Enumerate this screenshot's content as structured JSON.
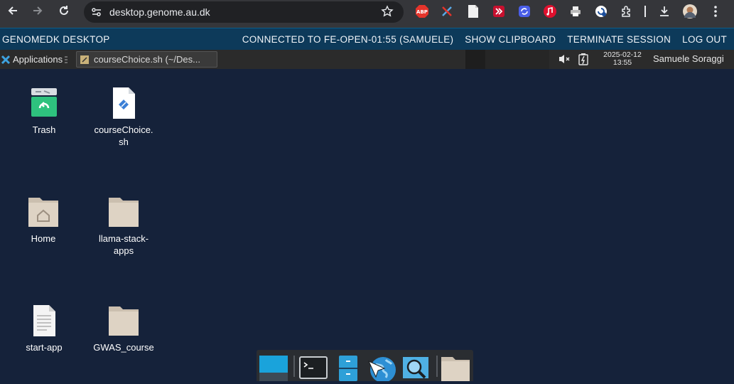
{
  "browser": {
    "url": "desktop.genome.au.dk",
    "extensions": [
      "abp-icon",
      "puzzle-x-icon",
      "doc-icon",
      "redbox-icon",
      "sync-icon",
      "music-icon",
      "printer-icon",
      "refresh-icon",
      "extensions-icon"
    ],
    "abp_label": "ABP"
  },
  "guac": {
    "brand": "GENOMEDK DESKTOP",
    "connected": "CONNECTED TO FE-OPEN-01:55 (SAMUELE)",
    "show_clipboard": "SHOW CLIPBOARD",
    "terminate": "TERMINATE SESSION",
    "logout": "LOG OUT"
  },
  "panel": {
    "applications": "Applications",
    "task_title": "courseChoice.sh (~/Des...",
    "date": "2025-02-12",
    "time": "13:55",
    "user": "Samuele Soraggi"
  },
  "desktop": {
    "trash": "Trash",
    "course_choice": "courseChoice.\nsh",
    "home": "Home",
    "llama": "llama-stack-\napps",
    "start_app": "start-app",
    "gwas": "GWAS_course"
  },
  "colors": {
    "desktop_bg": "#15223a",
    "guac_bar": "#0d3a5a",
    "panel": "#2b2b2b",
    "chrome": "#35363a"
  }
}
